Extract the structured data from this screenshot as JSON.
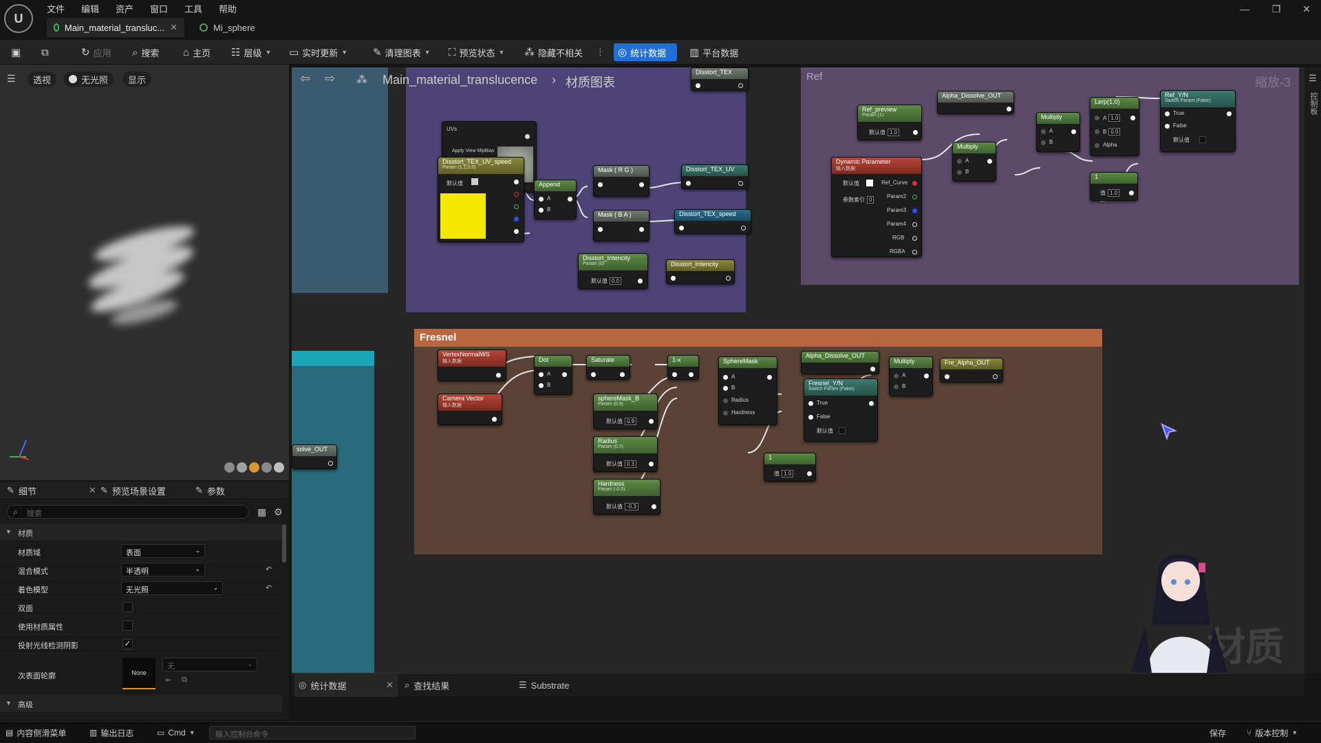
{
  "menu": [
    "文件",
    "编辑",
    "资产",
    "窗口",
    "工具",
    "帮助"
  ],
  "tabs": [
    {
      "label": "Main_material_transluc..."
    },
    {
      "label": "Mi_sphere"
    }
  ],
  "toolbar": {
    "apply": "应用",
    "search": "搜索",
    "home": "主页",
    "hierarchy": "层级",
    "live_update": "实时更新",
    "clean_graph": "清理图表",
    "preview_state": "预览状态",
    "hide_unrelated": "隐藏不相关",
    "stats": "统计数据",
    "platform_stats": "平台数据"
  },
  "viewport": {
    "perspective": "透视",
    "unlit": "无光照",
    "show": "显示"
  },
  "details": {
    "tabs": [
      "细节",
      "预览场景设置",
      "参数"
    ],
    "search_placeholder": "搜索",
    "section_material": "材质",
    "rows": [
      {
        "label": "材质域",
        "value": "表面"
      },
      {
        "label": "混合模式",
        "value": "半透明"
      },
      {
        "label": "着色模型",
        "value": "无光照"
      },
      {
        "label": "双面",
        "checked": false
      },
      {
        "label": "使用材质属性",
        "checked": false
      },
      {
        "label": "投射光线检测阴影",
        "checked": true
      }
    ],
    "subsurface_label": "次表面轮廓",
    "subsurface_thumb": "None",
    "subsurface_value": "无",
    "section_advanced": "高级"
  },
  "graph": {
    "breadcrumb_root": "Main_material_translucence",
    "breadcrumb_child": "材质图表",
    "zoom": "缩放-3",
    "watermark": "材质",
    "ref_comment": "Ref",
    "fresnel_comment": "Fresnel",
    "right_panel_label": "控制板",
    "nodes": {
      "disstort_tex_top": "Disstort_TEX",
      "apply_mip": "Apply View MipBias",
      "disstort_uv_speed": "Disstort_TEX_UV_speed",
      "disstort_uv_speed_sub": "Param (1,1,0,0)",
      "default": "默认值",
      "append": "Append",
      "mask_rg": "Mask ( R G )",
      "mask_ba": "Mask ( B A )",
      "disstort_tex_uv": "Disstort_TEX_UV",
      "disstort_tex_speed": "Disstort_TEX_speed",
      "disstort_intencity_param": "Disstort_Intencity",
      "disstort_intencity_sub": "Param (0)",
      "disstort_intencity_val": "0.0",
      "disstort_intencity_out": "Disstort_Intencity",
      "ref_preview": "Ref_preview",
      "ref_preview_sub": "Param (1)",
      "ref_preview_val": "1.0",
      "alpha_dissolve_top": "Alpha_Dissolve_OUT",
      "multiply": "Multiply",
      "lerp": "Lerp(1,0)",
      "lerp_a": "1.0",
      "lerp_b": "0.0",
      "alpha": "Alpha",
      "ref_yn": "Ref_Y/N",
      "ref_yn_sub": "Switch Param (False)",
      "true": "True",
      "false": "False",
      "dynamic_param": "Dynamic Parameter",
      "dynamic_param_sub": "输入数据",
      "ref_curve": "Ref_Curve",
      "param2": "Param2",
      "param3": "Param3",
      "param4": "Param4",
      "rgb": "RGB",
      "rgba": "RGBA",
      "param_index": "参数索引",
      "param_index_val": "0",
      "one": "1",
      "one_val": "1.0",
      "value": "值",
      "vertex_normal": "VertexNormalWS",
      "input_data": "输入数据",
      "camera_vector": "Camera Vector",
      "dot": "Dot",
      "saturate": "Saturate",
      "one_minus": "1-x",
      "sphere_mask": "SphereMask",
      "radius": "Radius",
      "hardness": "Hardness",
      "sphere_mask_b": "sphereMask_B",
      "sphere_mask_b_sub": "Param (0.9)",
      "sphere_mask_b_val": "0.9",
      "radius_param": "Radius",
      "radius_sub": "Param (0.3)",
      "radius_val": "0.3",
      "hardness_param": "Hardness",
      "hardness_sub": "Param (-0.3)",
      "hardness_val": "-0.3",
      "alpha_dissolve_mid": "Alpha_Dissolve_OUT",
      "fresnel_yn": "Fresnel_Y/N",
      "fresnel_yn_sub": "Switch Param (False)",
      "fre_alpha_out": "Fre_Alpha_OUT",
      "solve_out": "solve_OUT"
    }
  },
  "bottom_tabs": [
    "统计数据",
    "查找结果",
    "Substrate"
  ],
  "statusbar": {
    "content_drawer": "内容侧滑菜单",
    "output_log": "输出日志",
    "cmd": "Cmd",
    "console_placeholder": "输入控制台命令",
    "save": "保存",
    "source_control": "版本控制"
  },
  "colors": {
    "accent": "#1f6fd6",
    "ref_comment": "#6e5a7a",
    "distort_comment": "#5c4f82",
    "fresnel_comment": "#6b4f3f",
    "fresnel_header": "#c06b45"
  }
}
